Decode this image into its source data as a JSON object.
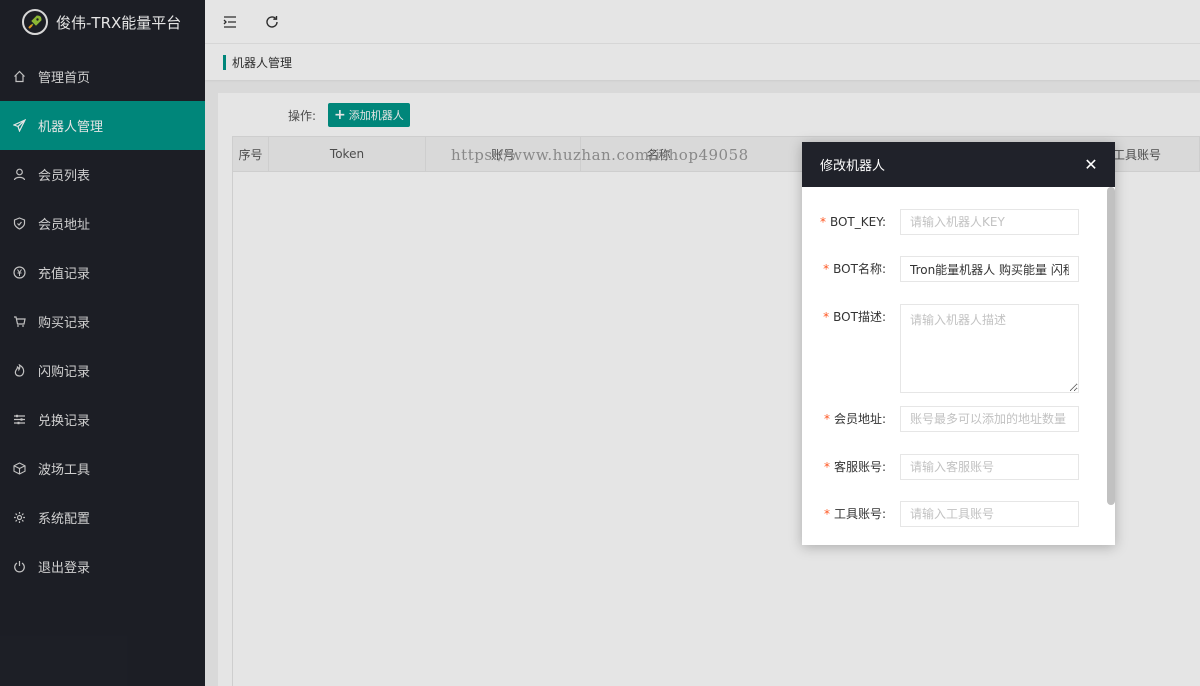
{
  "app": {
    "title": "俊伟-TRX能量平台"
  },
  "sidebar": {
    "items": [
      {
        "label": "管理首页",
        "icon": "home-icon",
        "active": false
      },
      {
        "label": "机器人管理",
        "icon": "send-icon",
        "active": true
      },
      {
        "label": "会员列表",
        "icon": "user-icon",
        "active": false
      },
      {
        "label": "会员地址",
        "icon": "shield-icon",
        "active": false
      },
      {
        "label": "充值记录",
        "icon": "yen-icon",
        "active": false
      },
      {
        "label": "购买记录",
        "icon": "cart-icon",
        "active": false
      },
      {
        "label": "闪购记录",
        "icon": "fire-icon",
        "active": false
      },
      {
        "label": "兑换记录",
        "icon": "sliders-icon",
        "active": false
      },
      {
        "label": "波场工具",
        "icon": "cube-icon",
        "active": false
      },
      {
        "label": "系统配置",
        "icon": "gear-icon",
        "active": false
      },
      {
        "label": "退出登录",
        "icon": "power-icon",
        "active": false
      }
    ]
  },
  "breadcrumb": {
    "current": "机器人管理"
  },
  "toolbar": {
    "ops_label": "操作:",
    "add_label": "添加机器人"
  },
  "table": {
    "columns": [
      "序号",
      "Token",
      "账号",
      "名称",
      "工具账号"
    ]
  },
  "watermark": "https://www.huzhan.com/ishop49058",
  "modal": {
    "title": "修改机器人",
    "fields": [
      {
        "label": "BOT_KEY:",
        "value": "",
        "placeholder": "请输入机器人KEY"
      },
      {
        "label": "BOT名称:",
        "value": "Tron能量机器人 购买能量 闪租",
        "placeholder": ""
      },
      {
        "label": "BOT描述:",
        "value": "",
        "placeholder": "请输入机器人描述"
      },
      {
        "label": "会员地址:",
        "value": "",
        "placeholder": "账号最多可以添加的地址数量"
      },
      {
        "label": "客服账号:",
        "value": "",
        "placeholder": "请输入客服账号"
      },
      {
        "label": "工具账号:",
        "value": "",
        "placeholder": "请输入工具账号"
      }
    ]
  },
  "colors": {
    "accent": "#009688",
    "sidebar_bg": "#20222a",
    "required": "#ff5722"
  }
}
